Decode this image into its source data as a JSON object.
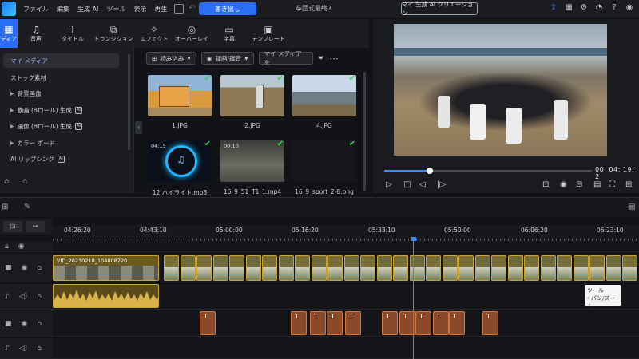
{
  "menu": [
    "ファイル",
    "編集",
    "生成 AI",
    "ツール",
    "表示",
    "再生"
  ],
  "toolbar": {
    "export_label": "書き出し",
    "project_title": "卒団式最終2",
    "ai_creation_label": "マイ 生成 AI クリエーション"
  },
  "tool_tabs": [
    {
      "label": "ディア",
      "icon": "media-icon",
      "glyph": "▦"
    },
    {
      "label": "音声",
      "icon": "music-icon",
      "glyph": "♫"
    },
    {
      "label": "タイトル",
      "icon": "title-icon",
      "glyph": "T"
    },
    {
      "label": "トランジション",
      "icon": "transition-icon",
      "glyph": "⧉"
    },
    {
      "label": "エフェクト",
      "icon": "effect-icon",
      "glyph": "✧"
    },
    {
      "label": "オーバーレイ",
      "icon": "overlay-icon",
      "glyph": "◎"
    },
    {
      "label": "字幕",
      "icon": "subtitle-icon",
      "glyph": "▭"
    },
    {
      "label": "テンプレート",
      "icon": "template-icon",
      "glyph": "▣"
    }
  ],
  "left_nav": [
    {
      "label": "マイ メディア",
      "selected": true,
      "arrow": false,
      "badge": false
    },
    {
      "label": "ストック素材",
      "selected": false,
      "arrow": false,
      "badge": false
    },
    {
      "label": "背景画像",
      "selected": false,
      "arrow": true,
      "badge": false
    },
    {
      "label": "動画 (Bロール) 生成",
      "selected": false,
      "arrow": true,
      "badge": true
    },
    {
      "label": "画像 (Bロール) 生成",
      "selected": false,
      "arrow": true,
      "badge": true
    },
    {
      "label": "カラー ボード",
      "selected": false,
      "arrow": true,
      "badge": false
    },
    {
      "label": "AI リップシンク",
      "selected": false,
      "arrow": false,
      "badge": true
    }
  ],
  "media_bar": {
    "import_label": "読み込み",
    "record_label": "録画/録音",
    "search_placeholder": "マイ メディアを"
  },
  "media_items": [
    {
      "label": "1.JPG",
      "duration": "",
      "kind": "photo1"
    },
    {
      "label": "2.JPG",
      "duration": "",
      "kind": "photo2"
    },
    {
      "label": "4.JPG",
      "duration": "",
      "kind": "photo3"
    },
    {
      "label": "12.ハイライト.mp3",
      "duration": "04:15",
      "kind": "audio"
    },
    {
      "label": "16_9_51_T1_1.mp4",
      "duration": "00:10",
      "kind": "blur"
    },
    {
      "label": "16_9_sport_2-8.png",
      "duration": "",
      "kind": "dark"
    }
  ],
  "preview": {
    "timecode": "00: 04: 19: 2",
    "progress": 0.22
  },
  "ruler": [
    "04:26:20",
    "04:43:10",
    "05:00:00",
    "05:16:20",
    "05:33:10",
    "05:50:00",
    "06:06:20",
    "06:23:10"
  ],
  "timeline": {
    "first_clip_name": "VID_20230218_104808220",
    "tooltip_line1": "ツール",
    "tooltip_line2": "- パン/ズーム"
  },
  "colors": {
    "accent": "#2b6df5",
    "check": "#3fd04c",
    "video_clip": "#c9a43a",
    "title_clip": "#d9763e"
  }
}
